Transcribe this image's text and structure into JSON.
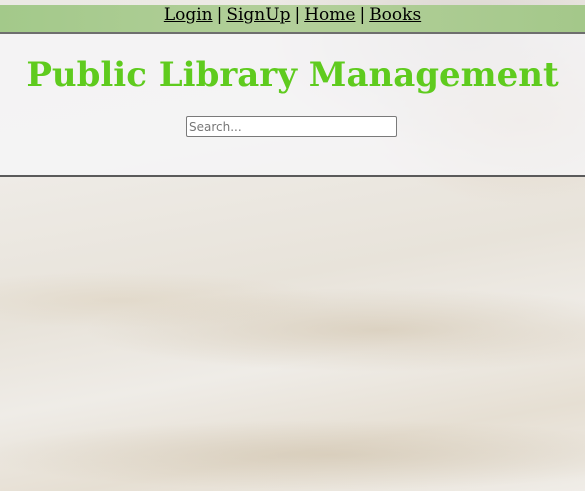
{
  "nav": {
    "links": [
      "Login",
      "SignUp",
      "Home",
      "Books"
    ],
    "separator": "|"
  },
  "header": {
    "title": "Public Library Management"
  },
  "search": {
    "placeholder": "Search...",
    "value": ""
  },
  "colors": {
    "title": "#5fcb1e",
    "nav_bar": "#a9cb90"
  }
}
